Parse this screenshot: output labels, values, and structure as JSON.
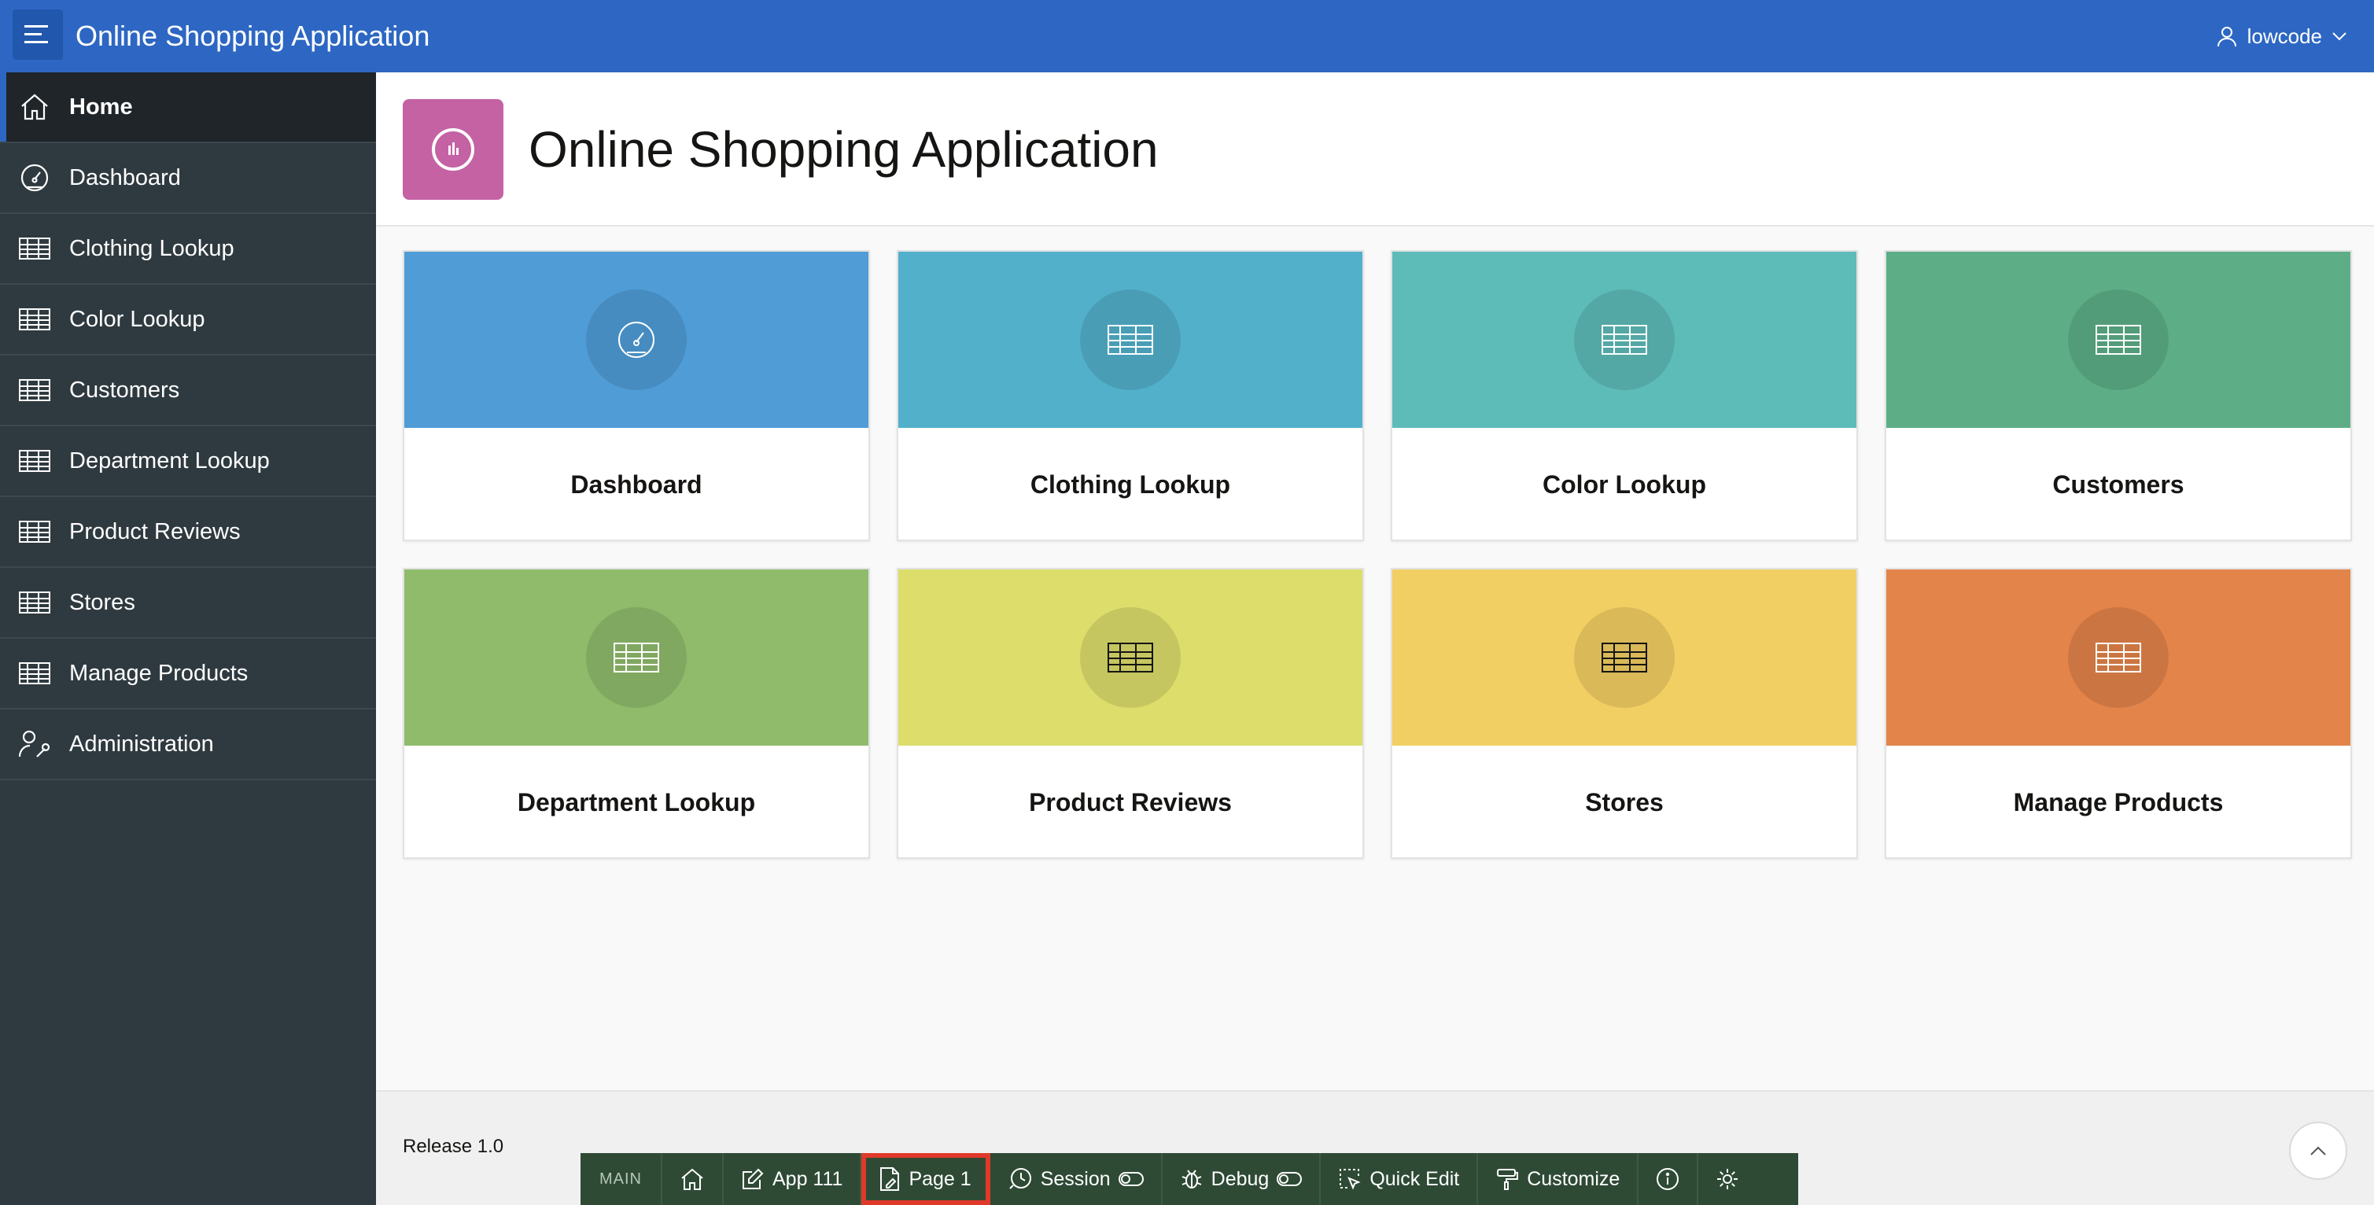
{
  "header": {
    "app_title": "Online Shopping Application",
    "username": "lowcode"
  },
  "sidebar": {
    "items": [
      {
        "label": "Home",
        "icon": "home-icon",
        "active": true
      },
      {
        "label": "Dashboard",
        "icon": "dashboard-icon"
      },
      {
        "label": "Clothing Lookup",
        "icon": "table-icon"
      },
      {
        "label": "Color Lookup",
        "icon": "table-icon"
      },
      {
        "label": "Customers",
        "icon": "table-icon"
      },
      {
        "label": "Department Lookup",
        "icon": "table-icon"
      },
      {
        "label": "Product Reviews",
        "icon": "table-icon"
      },
      {
        "label": "Stores",
        "icon": "table-icon"
      },
      {
        "label": "Manage Products",
        "icon": "table-icon"
      },
      {
        "label": "Administration",
        "icon": "user-wrench-icon"
      }
    ]
  },
  "hero": {
    "title": "Online Shopping Application",
    "icon": "chart-donut-icon",
    "icon_color": "#c462a4"
  },
  "cards": [
    {
      "title": "Dashboard",
      "icon": "dashboard-icon",
      "color": "#4f9cd6"
    },
    {
      "title": "Clothing Lookup",
      "icon": "table-icon",
      "color": "#52b0cb"
    },
    {
      "title": "Color Lookup",
      "icon": "table-icon",
      "color": "#5dbbb8"
    },
    {
      "title": "Customers",
      "icon": "table-icon",
      "color": "#5dae87"
    },
    {
      "title": "Department Lookup",
      "icon": "table-icon",
      "color": "#8fbb6b"
    },
    {
      "title": "Product Reviews",
      "icon": "table-icon",
      "color": "#dcdd6b"
    },
    {
      "title": "Stores",
      "icon": "table-icon",
      "color": "#f2cf63"
    },
    {
      "title": "Manage Products",
      "icon": "table-icon",
      "color": "#e3844a"
    }
  ],
  "footer": {
    "release": "Release 1.0"
  },
  "devbar": {
    "main": "MAIN",
    "app": "App 111",
    "page": "Page 1",
    "session": "Session",
    "debug": "Debug",
    "quick_edit": "Quick Edit",
    "customize": "Customize"
  },
  "colors": {
    "header_bg": "#2d67c3",
    "sidebar_bg": "#2f3a40",
    "devbar_bg": "#2e4a35",
    "highlight": "#e0392a"
  }
}
